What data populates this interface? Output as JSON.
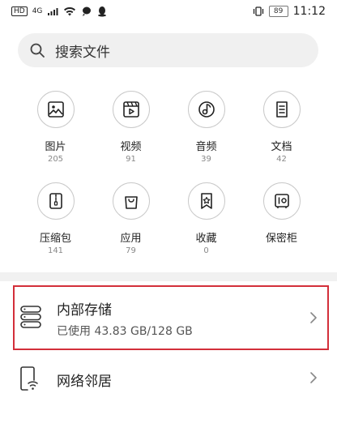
{
  "status_bar": {
    "network_label": "HD",
    "signal_label": "4G",
    "battery": "89",
    "time": "11:12"
  },
  "search": {
    "placeholder": "搜索文件"
  },
  "categories": [
    {
      "label": "图片",
      "count": "205",
      "icon": "image-icon"
    },
    {
      "label": "视频",
      "count": "91",
      "icon": "video-icon"
    },
    {
      "label": "音频",
      "count": "39",
      "icon": "music-icon"
    },
    {
      "label": "文档",
      "count": "42",
      "icon": "document-icon"
    },
    {
      "label": "压缩包",
      "count": "141",
      "icon": "zip-icon"
    },
    {
      "label": "应用",
      "count": "79",
      "icon": "shopping-bag-icon"
    },
    {
      "label": "收藏",
      "count": "0",
      "icon": "star-icon"
    },
    {
      "label": "保密柜",
      "count": "",
      "icon": "safe-icon"
    }
  ],
  "storage": {
    "title": "内部存储",
    "usage": "已使用 43.83 GB/128 GB",
    "highlight_color": "#d32f3a"
  },
  "network": {
    "title": "网络邻居"
  }
}
